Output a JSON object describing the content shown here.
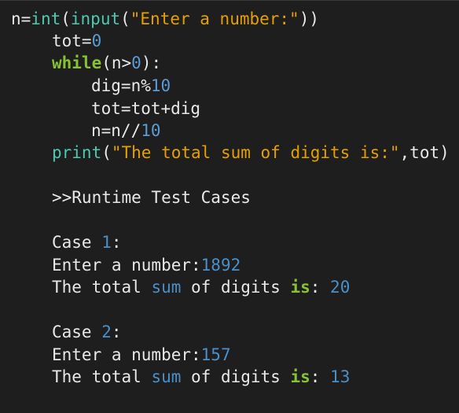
{
  "code": {
    "l1": {
      "a": "n=",
      "b": "int",
      "c": "(",
      "d": "input",
      "e": "(",
      "f": "\"Enter a number:\"",
      "g": "))"
    },
    "l2": {
      "a": "tot=",
      "b": "0"
    },
    "l3": {
      "a": "while",
      "b": "(n>",
      "c": "0",
      "d": "):"
    },
    "l4": {
      "a": "dig=n%",
      "b": "10"
    },
    "l5": {
      "a": "tot=tot+dig"
    },
    "l6": {
      "a": "n=n//",
      "b": "10"
    },
    "l7": {
      "a": "print",
      "b": "(",
      "c": "\"The total sum of digits is:\"",
      "d": ",tot)"
    }
  },
  "output": {
    "heading": ">>Runtime Test Cases",
    "case1": {
      "label": "Case ",
      "num": "1",
      "colon": ":",
      "prompt": "Enter a number:",
      "input": "1892",
      "result": {
        "w1": "The total ",
        "w2": "sum",
        "w3": " of digits ",
        "w4": "is",
        "w5": ": ",
        "w6": "20"
      }
    },
    "case2": {
      "label": "Case ",
      "num": "2",
      "colon": ":",
      "prompt": "Enter a number:",
      "input": "157",
      "result": {
        "w1": "The total ",
        "w2": "sum",
        "w3": " of digits ",
        "w4": "is",
        "w5": ": ",
        "w6": "13"
      }
    }
  }
}
